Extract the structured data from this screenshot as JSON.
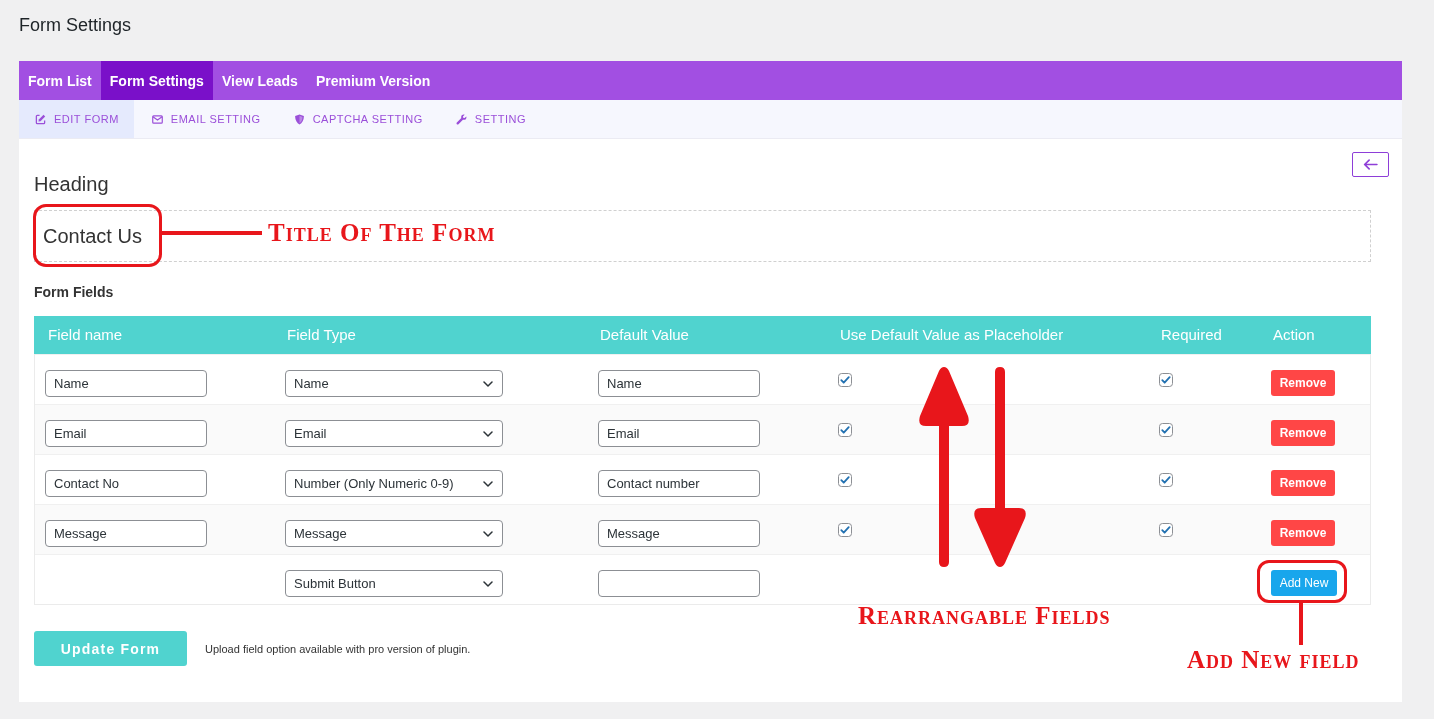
{
  "page_title": "Form Settings",
  "main_tabs": [
    {
      "label": "Form List",
      "selected": false
    },
    {
      "label": "Form Settings",
      "selected": true
    },
    {
      "label": "View Leads",
      "selected": false
    },
    {
      "label": "Premium Version",
      "selected": false
    }
  ],
  "sub_tabs": [
    {
      "label": "EDIT FORM",
      "selected": true
    },
    {
      "label": "EMAIL SETTING",
      "selected": false
    },
    {
      "label": "CAPTCHA SETTING",
      "selected": false
    },
    {
      "label": "SETTING",
      "selected": false
    }
  ],
  "heading_label": "Heading",
  "form_title": "Contact Us",
  "form_fields_label": "Form Fields",
  "table": {
    "columns": [
      "Field name",
      "Field Type",
      "Default Value",
      "Use Default Value as Placeholder",
      "Required",
      "Action"
    ],
    "rows": [
      {
        "kind": "field",
        "field_name": "Name",
        "field_type": "Name",
        "default_value": "Name",
        "use_default_as_placeholder": true,
        "required": true,
        "action": "Remove"
      },
      {
        "kind": "field",
        "field_name": "Email",
        "field_type": "Email",
        "default_value": "Email",
        "use_default_as_placeholder": true,
        "required": true,
        "action": "Remove"
      },
      {
        "kind": "field",
        "field_name": "Contact No",
        "field_type": "Number (Only Numeric 0-9)",
        "default_value": "Contact number",
        "use_default_as_placeholder": true,
        "required": true,
        "action": "Remove"
      },
      {
        "kind": "field",
        "field_name": "Message",
        "field_type": "Message",
        "default_value": "Message",
        "use_default_as_placeholder": true,
        "required": true,
        "action": "Remove"
      },
      {
        "kind": "submit",
        "field_type": "Submit Button",
        "action": "Add New"
      }
    ]
  },
  "update_button": "Update Form",
  "note": "Upload field option available with pro version of plugin.",
  "annotations": {
    "title_callout": "Title Of The Form",
    "reorder_label": "Rearrangable Fields",
    "add_new_callout": "Add New field"
  }
}
